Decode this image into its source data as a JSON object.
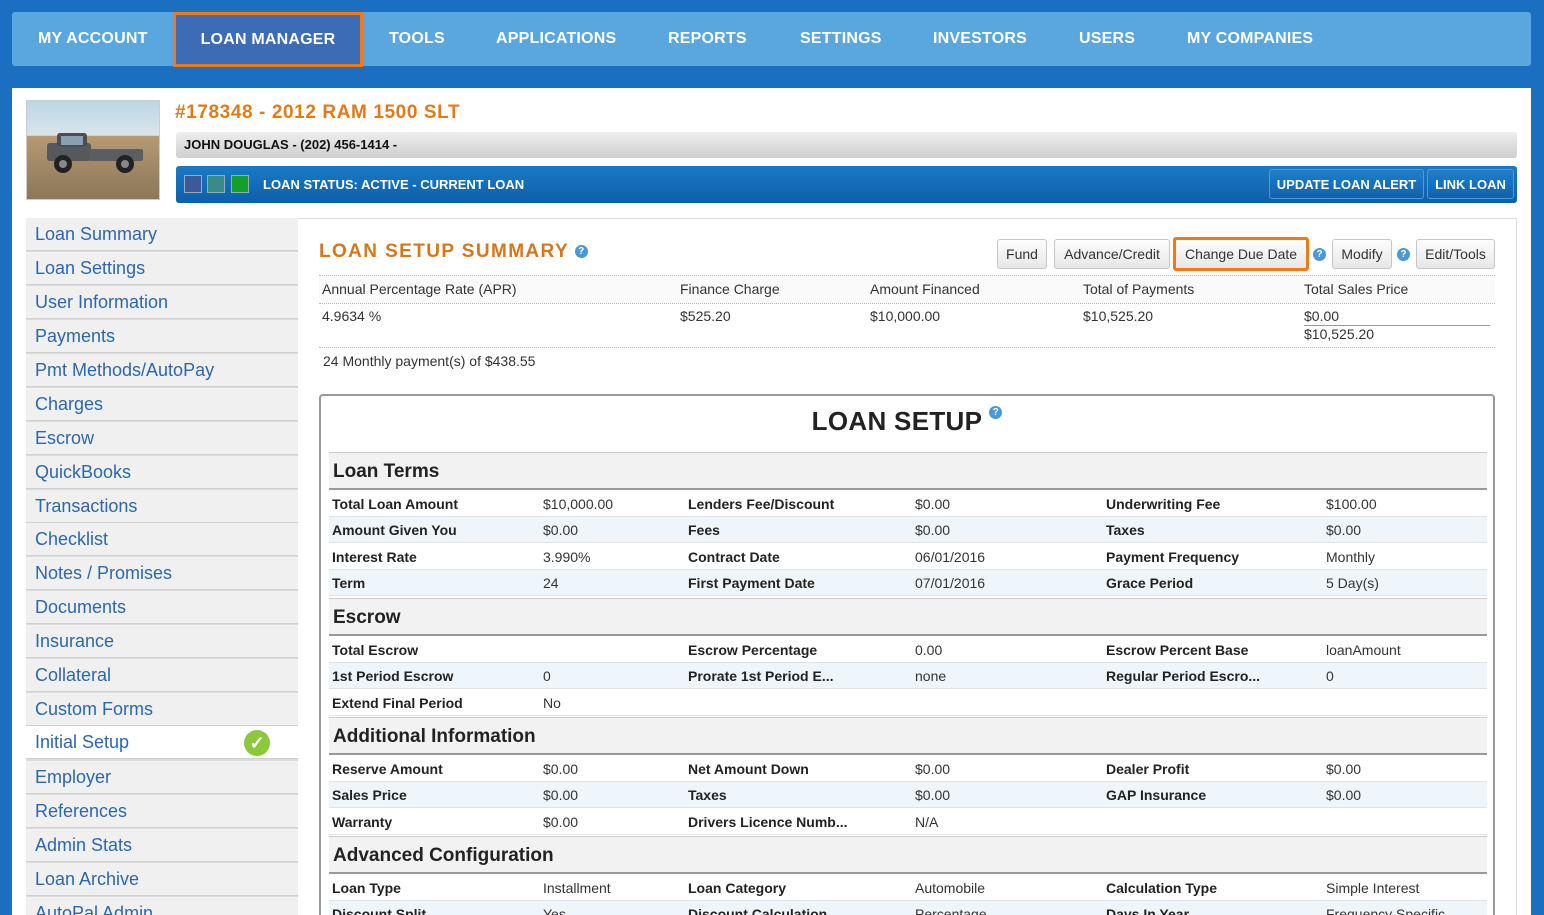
{
  "nav": {
    "items": [
      "MY ACCOUNT",
      "LOAN MANAGER",
      "TOOLS",
      "APPLICATIONS",
      "REPORTS",
      "SETTINGS",
      "INVESTORS",
      "USERS",
      "MY COMPANIES"
    ],
    "active": "LOAN MANAGER"
  },
  "loan": {
    "title": "#178348 - 2012 RAM 1500 SLT",
    "borrower": "JOHN DOUGLAS - (202) 456-1414 -",
    "status": "LOAN STATUS: ACTIVE - CURRENT LOAN",
    "update_alert": "UPDATE LOAN ALERT",
    "link_loan": "LINK LOAN"
  },
  "sidebar": {
    "items": [
      "Loan Summary",
      "Loan Settings",
      "User Information",
      "Payments",
      "Pmt Methods/AutoPay",
      "Charges",
      "Escrow",
      "QuickBooks",
      "Transactions",
      "Checklist",
      "Notes / Promises",
      "Documents",
      "Insurance",
      "Collateral",
      "Custom Forms",
      "Initial Setup",
      "Employer",
      "References",
      "Admin Stats",
      "Loan Archive",
      "AutoPal Admin"
    ],
    "active": "Initial Setup"
  },
  "summary": {
    "title": "LOAN SETUP SUMMARY",
    "buttons": {
      "fund": "Fund",
      "advance": "Advance/Credit",
      "change_due": "Change Due Date",
      "modify": "Modify",
      "edit_tools": "Edit/Tools"
    },
    "headers": {
      "apr": "Annual Percentage Rate (APR)",
      "finance": "Finance Charge",
      "financed": "Amount Financed",
      "total_payments": "Total of Payments",
      "total_sales": "Total Sales Price"
    },
    "values": {
      "apr": "4.9634 %",
      "finance": "$525.20",
      "financed": "$10,000.00",
      "total_payments": "$10,525.20",
      "total_sales_1": "$0.00",
      "total_sales_2": "$10,525.20"
    },
    "monthly": "24 Monthly payment(s) of $438.55"
  },
  "setup": {
    "title": "LOAN SETUP",
    "loan_terms": {
      "heading": "Loan Terms",
      "rows": [
        [
          "Total Loan Amount",
          "$10,000.00",
          "Lenders Fee/Discount",
          "$0.00",
          "Underwriting Fee",
          "$100.00"
        ],
        [
          "Amount Given You",
          "$0.00",
          "Fees",
          "$0.00",
          "Taxes",
          "$0.00"
        ],
        [
          "Interest Rate",
          "3.990%",
          "Contract Date",
          "06/01/2016",
          "Payment Frequency",
          "Monthly"
        ],
        [
          "Term",
          "24",
          "First Payment Date",
          "07/01/2016",
          "Grace Period",
          "5 Day(s)"
        ]
      ]
    },
    "escrow": {
      "heading": "Escrow",
      "rows": [
        [
          "Total Escrow",
          "",
          "Escrow Percentage",
          "0.00",
          "Escrow Percent Base",
          "loanAmount"
        ],
        [
          "1st Period Escrow",
          "0",
          "Prorate 1st Period E...",
          "none",
          "Regular Period Escro...",
          "0"
        ],
        [
          "Extend Final Period",
          "No",
          "",
          "",
          "",
          ""
        ]
      ]
    },
    "additional": {
      "heading": "Additional Information",
      "rows": [
        [
          "Reserve Amount",
          "$0.00",
          "Net Amount Down",
          "$0.00",
          "Dealer Profit",
          "$0.00"
        ],
        [
          "Sales Price",
          "$0.00",
          "Taxes",
          "$0.00",
          "GAP Insurance",
          "$0.00"
        ],
        [
          "Warranty",
          "$0.00",
          "Drivers Licence Numb...",
          "N/A",
          "",
          ""
        ]
      ]
    },
    "advanced": {
      "heading": "Advanced Configuration",
      "rows": [
        [
          "Loan Type",
          "Installment",
          "Loan Category",
          "Automobile",
          "Calculation Type",
          "Simple Interest"
        ],
        [
          "Discount Split",
          "Yes",
          "Discount Calculation",
          "Percentage",
          "Days In Year",
          "Frequency Specific"
        ]
      ]
    }
  }
}
